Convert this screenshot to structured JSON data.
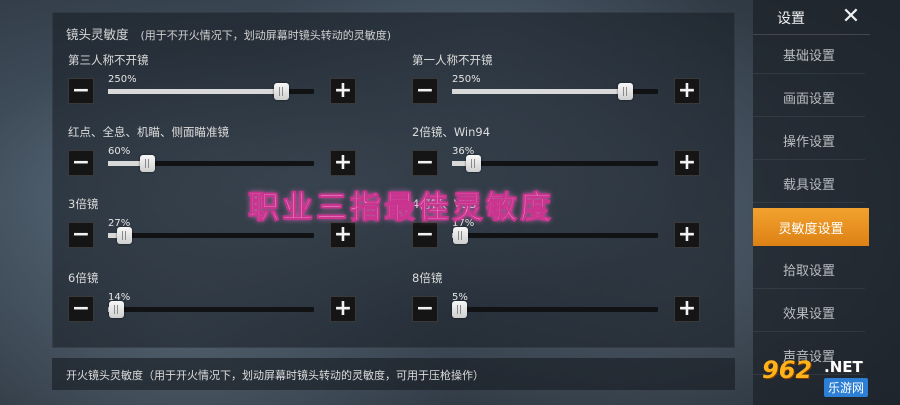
{
  "header": {
    "title": "镜头灵敏度",
    "note": "(用于不开火情况下，划动屏幕时镜头转动的灵敏度)"
  },
  "sliders": [
    {
      "label": "第三人称不开镜",
      "value": "250%",
      "fraction": 0.84
    },
    {
      "label": "第一人称不开镜",
      "value": "250%",
      "fraction": 0.84
    },
    {
      "label": "红点、全息、机瞄、侧面瞄准镜",
      "value": "60%",
      "fraction": 0.19
    },
    {
      "label": "2倍镜、Win94",
      "value": "36%",
      "fraction": 0.1
    },
    {
      "label": "3倍镜",
      "value": "27%",
      "fraction": 0.08
    },
    {
      "label": "4倍镜、VSS",
      "value": "17%",
      "fraction": 0.04
    },
    {
      "label": "6倍镜",
      "value": "14%",
      "fraction": 0.04
    },
    {
      "label": "8倍镜",
      "value": "5%",
      "fraction": 0.0
    }
  ],
  "buttons": {
    "minus": "−",
    "plus": "+"
  },
  "footer": {
    "text": "开火镜头灵敏度（用于开火情况下，划动屏幕时镜头转动的灵敏度，可用于压枪操作）"
  },
  "sidebar": {
    "title": "设置",
    "close": "✕",
    "items": [
      {
        "label": "基础设置",
        "active": false
      },
      {
        "label": "画面设置",
        "active": false
      },
      {
        "label": "操作设置",
        "active": false
      },
      {
        "label": "载具设置",
        "active": false
      },
      {
        "label": "灵敏度设置",
        "active": true
      },
      {
        "label": "拾取设置",
        "active": false
      },
      {
        "label": "效果设置",
        "active": false
      },
      {
        "label": "声音设置",
        "active": false
      }
    ]
  },
  "overlay": {
    "caption": "职业三指最佳灵敏度"
  },
  "watermark": {
    "logo": "962",
    "net": ".NET",
    "cn": "乐游网"
  },
  "colors": {
    "accent": "#f2a22e",
    "overlay_text": "#ffd3f2",
    "overlay_stroke": "#c9348f"
  }
}
